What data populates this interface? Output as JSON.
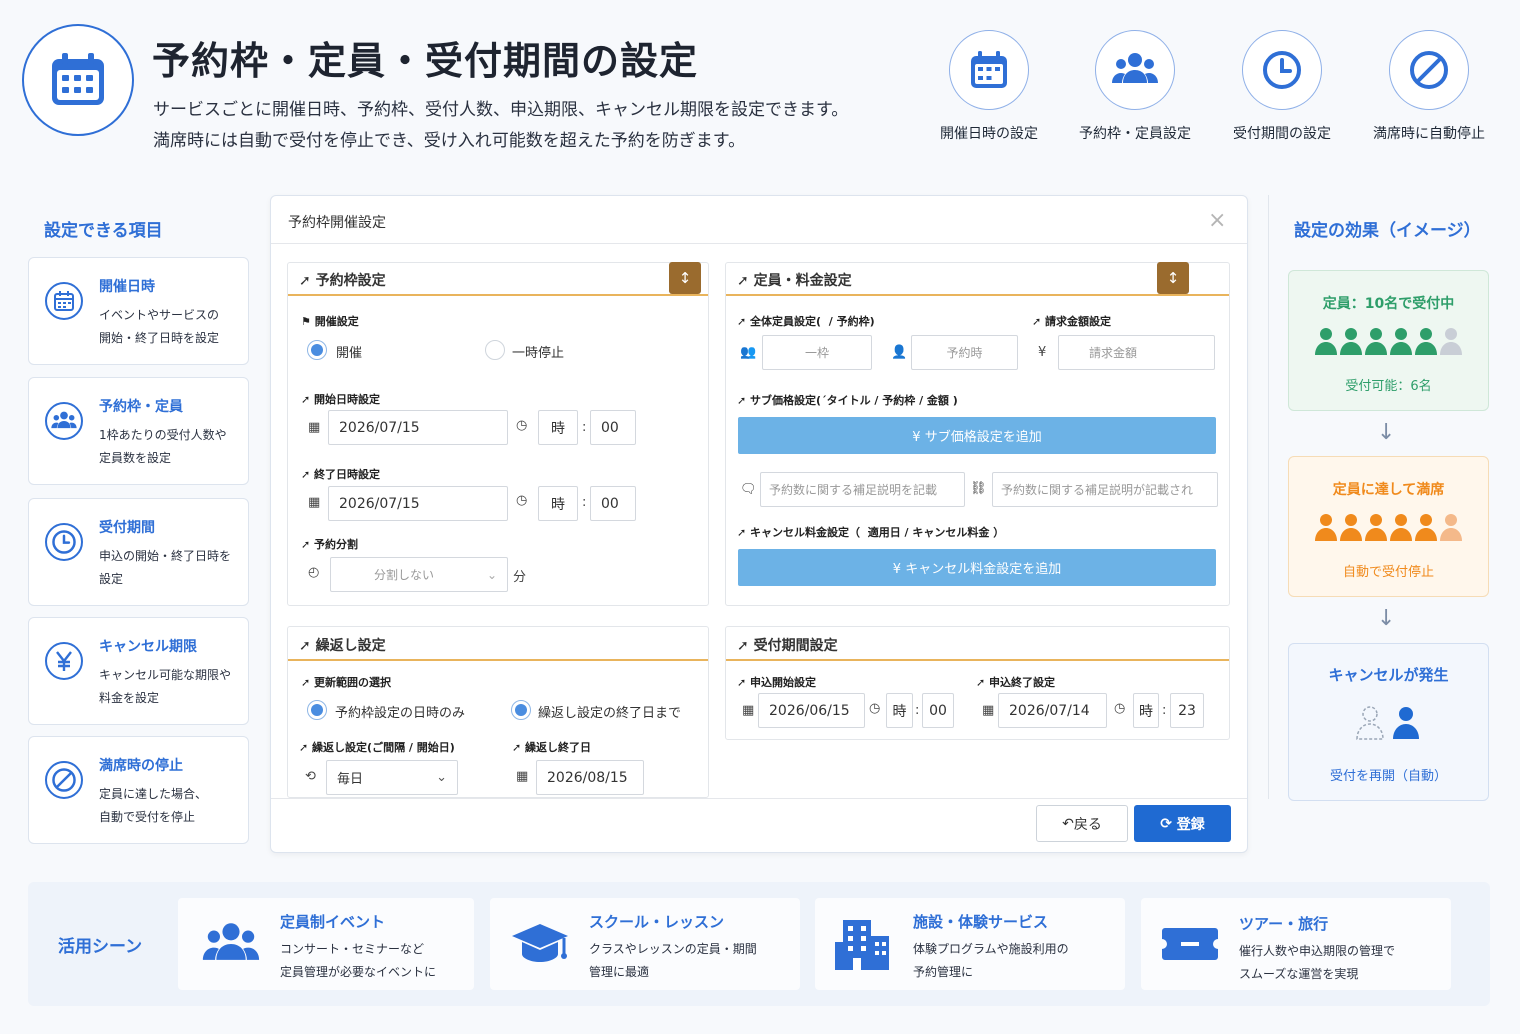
{
  "header": {
    "title": "予約枠・定員・受付期間の設定",
    "desc1": "サービスごとに開催日時、予約枠、受付人数、申込期限、キャンセル期限を設定できます。",
    "desc2": "満席時には自動で受付を停止でき、受け入れ可能数を超えた予約を防ぎます。",
    "features": [
      {
        "label": "開催日時の設定",
        "icon": "calendar-icon"
      },
      {
        "label": "予約枠・定員設定",
        "icon": "users-icon"
      },
      {
        "label": "受付期間の設定",
        "icon": "clock-icon"
      },
      {
        "label": "満席時に自動停止",
        "icon": "ban-icon"
      }
    ]
  },
  "left": {
    "title": "設定できる項目",
    "items": [
      {
        "title": "開催日時",
        "d1": "イベントやサービスの",
        "d2": "開始・終了日時を設定"
      },
      {
        "title": "予約枠・定員",
        "d1": "1枠あたりの受付人数や",
        "d2": "定員数を設定"
      },
      {
        "title": "受付期間",
        "d1": "申込の開始・終了日時を",
        "d2": "設定"
      },
      {
        "title": "キャンセル期限",
        "d1": "キャンセル可能な期限や",
        "d2": "料金を設定"
      },
      {
        "title": "満席時の停止",
        "d1": "定員に達した場合、",
        "d2": "自動で受付を停止"
      }
    ]
  },
  "dialog": {
    "title": "予約枠開催設定",
    "close": "×",
    "p1": {
      "heading": "予約枠設定",
      "open_label": "開催設定",
      "radio_on": "開催",
      "radio_off": "一時停止",
      "start_label": "開始日時設定",
      "start_date": "2026/07/15",
      "start_hour": "時",
      "start_min": "00",
      "end_label": "終了日時設定",
      "end_date": "2026/07/15",
      "end_hour": "時",
      "end_min": "00",
      "split_label": "予約分割",
      "split_value": "分割しない",
      "split_unit": "分"
    },
    "p2": {
      "heading": "定員・料金設定",
      "cap_label": "全体定員設定(  / 予約枠)",
      "cap_value": "一枠",
      "cap_time": "予約時",
      "bill_label": "請求金額設定",
      "bill_placeholder": "請求金額",
      "sub_label": "サブ価格設定(´タイトル / 予約枠 / 金額 )",
      "sub_btn": "¥ サブ価格設定を追加",
      "note_placeholder": "予約数に関する補足説明を記載",
      "note_placeholder2": "予約数に関する補足説明が記載され",
      "cancel_label": "キャンセル料金設定（  適用日 / キャンセル料金 ）",
      "cancel_btn": "¥ キャンセル料金設定を追加"
    },
    "p3": {
      "heading": "繰返し設定",
      "range_label": "更新範囲の選択",
      "r1": "予約枠設定の日時のみ",
      "r2": "繰返し設定の終了日まで",
      "rep_label": "繰返し設定(ご間隔 / 開始日)",
      "rep_value": "毎日",
      "rep_end_label": "繰返し終了日",
      "rep_end": "2026/08/15"
    },
    "p4": {
      "heading": "受付期間設定",
      "apply_start_label": "申込開始設定",
      "apply_start_date": "2026/06/15",
      "apply_start_hour": "時",
      "apply_start_min": "00",
      "apply_end_label": "申込終了設定",
      "apply_end_date": "2026/07/14",
      "apply_end_hour": "時",
      "apply_end_min": "23"
    },
    "back": "戻る",
    "save": "登録"
  },
  "right": {
    "title": "設定の効果（イメージ）",
    "c1": {
      "title": "定員：10名で受付中",
      "sub": "受付可能：6名"
    },
    "c2": {
      "title": "定員に達して満席",
      "sub": "自動で受付停止"
    },
    "c3": {
      "title": "キャンセルが発生",
      "sub": "受付を再開（自動）"
    }
  },
  "usage": {
    "title": "活用シーン",
    "items": [
      {
        "title": "定員制イベント",
        "d1": "コンサート・セミナーなど",
        "d2": "定員管理が必要なイベントに"
      },
      {
        "title": "スクール・レッスン",
        "d1": "クラスやレッスンの定員・期間",
        "d2": "管理に最適"
      },
      {
        "title": "施設・体験サービス",
        "d1": "体験プログラムや施設利用の",
        "d2": "予約管理に"
      },
      {
        "title": "ツアー・旅行",
        "d1": "催行人数や申込期限の管理で",
        "d2": "スムーズな運営を実現"
      }
    ]
  },
  "colors": {
    "accent": "#2f6fd6",
    "green": "#2e9e6a",
    "orange": "#f08a1c",
    "gold": "#e9b45c"
  }
}
